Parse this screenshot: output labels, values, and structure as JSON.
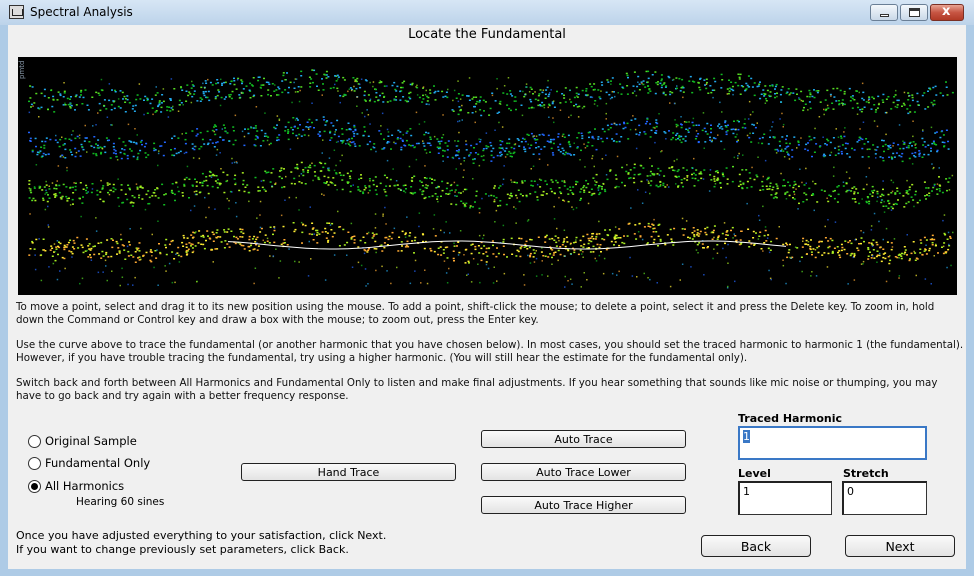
{
  "window": {
    "title": "Spectral Analysis",
    "minimize_icon": "minimize-icon",
    "maximize_icon": "maximize-icon",
    "close_icon": "close-icon",
    "close_glyph": "x"
  },
  "heading": "Locate the Fundamental",
  "spectrogram": {
    "axis_label": "pmtd",
    "colors": [
      "#11bb22",
      "#55dd22",
      "#aaee22",
      "#ffee33",
      "#ffaa33",
      "#2266ff",
      "#22aaee"
    ]
  },
  "instructions": [
    "To move a point, select and drag it to its new position using the mouse. To add a point, shift-click the mouse; to delete a point, select it and press the Delete key. To zoom in, hold down the Command or Control key and draw a box with the mouse; to zoom out, press the Enter key.",
    "Use the curve above to trace the fundamental (or another harmonic that you have chosen below). In most cases, you should set the traced harmonic to harmonic 1 (the fundamental). However, if you have trouble tracing the fundamental, try using a higher harmonic. (You will still hear the estimate for the fundamental only).",
    "Switch back and forth between All Harmonics and Fundamental Only to listen and make final adjustments.  If you hear something that sounds like mic noise or thumping, you may have to go back and try again with a better frequency response."
  ],
  "playback": {
    "options": [
      {
        "label": "Original Sample",
        "selected": false
      },
      {
        "label": "Fundamental Only",
        "selected": false
      },
      {
        "label": "All Harmonics",
        "selected": true
      }
    ],
    "status": "Hearing 60 sines"
  },
  "buttons": {
    "hand_trace": "Hand Trace",
    "auto_trace": "Auto Trace",
    "auto_trace_lower": "Auto Trace Lower",
    "auto_trace_higher": "Auto Trace Higher",
    "back": "Back",
    "next": "Next"
  },
  "fields": {
    "traced_harmonic": {
      "label": "Traced Harmonic",
      "value": "1"
    },
    "level": {
      "label": "Level",
      "value": "1"
    },
    "stretch": {
      "label": "Stretch",
      "value": "0"
    }
  },
  "footer": [
    "Once you have adjusted everything to your satisfaction, click Next.",
    "If you want to change previously set parameters, click Back."
  ]
}
